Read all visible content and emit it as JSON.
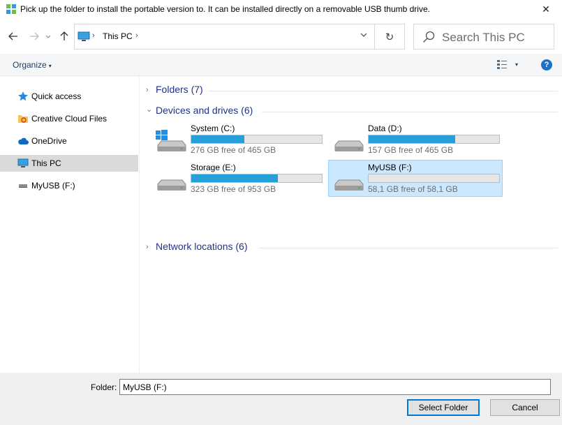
{
  "window": {
    "title": "Pick up the folder to install the portable version to. It can be installed directly on a removable USB thumb drive.",
    "close_glyph": "✕"
  },
  "navigation": {
    "back_icon": "arrow-left-icon",
    "forward_icon": "arrow-right-icon",
    "up_icon": "arrow-up-icon",
    "address": {
      "path": "This PC",
      "separator": "›"
    },
    "refresh_glyph": "↻",
    "search_placeholder": "Search This PC"
  },
  "toolbar": {
    "organize_label": "Organize",
    "caret": "▾",
    "help_glyph": "?"
  },
  "sidebar": {
    "items": [
      {
        "label": "Quick access",
        "icon": "star-icon"
      },
      {
        "label": "Creative Cloud Files",
        "icon": "creative-cloud-folder-icon"
      },
      {
        "label": "OneDrive",
        "icon": "cloud-icon"
      },
      {
        "label": "This PC",
        "icon": "computer-icon",
        "selected": true
      },
      {
        "label": "MyUSB (F:)",
        "icon": "usb-drive-icon"
      }
    ]
  },
  "groups": {
    "chevron_right": "›",
    "chevron_down": "⌄",
    "folders": {
      "title": "Folders (7)",
      "expanded": false
    },
    "devices": {
      "title": "Devices and drives (6)",
      "expanded": true
    },
    "network": {
      "title": "Network locations (6)",
      "expanded": false
    }
  },
  "drives": [
    {
      "name": "System (C:)",
      "free_text": "276 GB free of 465 GB",
      "used_fraction": 0.406,
      "icon": "windows-drive-icon"
    },
    {
      "name": "Data (D:)",
      "free_text": "157 GB free of 465 GB",
      "used_fraction": 0.662,
      "icon": "hard-drive-icon"
    },
    {
      "name": "Storage (E:)",
      "free_text": "323 GB free of 953 GB",
      "used_fraction": 0.661,
      "icon": "hard-drive-icon"
    },
    {
      "name": "MyUSB (F:)",
      "free_text": "58,1 GB free of 58,1 GB",
      "used_fraction": 0.0,
      "icon": "hard-drive-icon",
      "selected": true
    }
  ],
  "footer": {
    "folder_label": "Folder:",
    "folder_value": "MyUSB (F:)",
    "select_button": "Select Folder",
    "cancel_button": "Cancel"
  },
  "colors": {
    "accent": "#0078d7",
    "bar_fill": "#26a0da",
    "group_title": "#1e3287",
    "selection_bg": "#cce8ff"
  }
}
